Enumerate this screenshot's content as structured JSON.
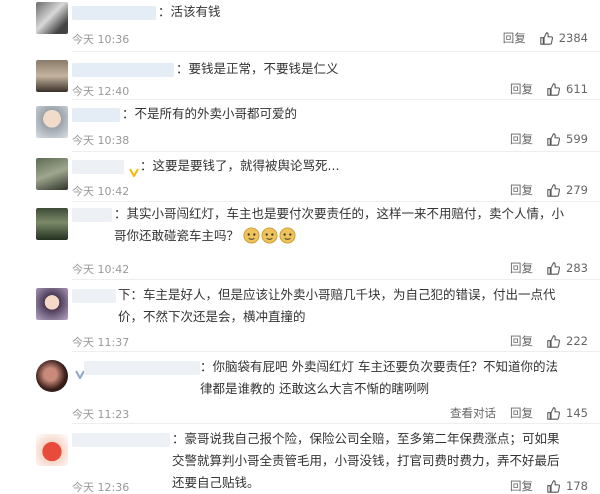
{
  "comments": [
    {
      "text": "：活该有钱",
      "time": "今天 10:36",
      "reply": "回复",
      "likes": "2384"
    },
    {
      "text": "：要钱是正常，不要钱是仁义",
      "time": "今天 12:40",
      "reply": "回复",
      "likes": "611"
    },
    {
      "text": "：不是所有的外卖小哥都可爱的",
      "time": "今天 10:38",
      "reply": "回复",
      "likes": "599"
    },
    {
      "text": "：这要是要钱了，就得被舆论骂死...",
      "time": "今天 10:42",
      "reply": "回复",
      "likes": "279"
    },
    {
      "text": "：其实小哥闯红灯，车主也是要付次要责任的，这样一来不用赔付，卖个人情，小哥你还敢碰瓷车主吗？",
      "time": "今天 10:42",
      "reply": "回复",
      "likes": "283"
    },
    {
      "text": "下：车主是好人，但是应该让外卖小哥赔几千块，为自己犯的错误，付出一点代价，不然下次还是会，横冲直撞的",
      "time": "今天 11:37",
      "reply": "回复",
      "likes": "222"
    },
    {
      "text": "：你脑袋有屁吧 外卖闯红灯 车主还要负次要责任？不知道你的法律都是谁教的 还敢这么大言不惭的瞎咧咧",
      "time": "今天 11:23",
      "view_conversation": "查看对话",
      "reply": "回复",
      "likes": "145"
    },
    {
      "text": "：豪哥说我自己报个险，保险公司全赔，至多第二年保费涨点；可如果交警就算判小哥全责管毛用，小哥没钱，打官司费时费力，弄不好最后还要自己贴钱。",
      "time": "今天 12:36",
      "reply": "回复",
      "likes": "178"
    }
  ]
}
